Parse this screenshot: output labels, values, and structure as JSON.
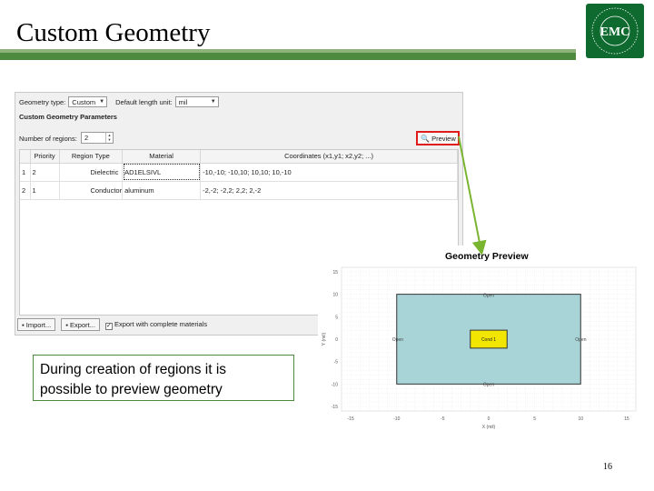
{
  "slide": {
    "title": "Custom Geometry",
    "page_number": "16"
  },
  "logo": {
    "text": "EMC",
    "ring_text": "TECHNOLOGY ELECTROMAGNETIC COMPATIBILITY"
  },
  "dialog": {
    "geometry_type_label": "Geometry type:",
    "geometry_type_value": "Custom",
    "length_unit_label": "Default length unit:",
    "length_unit_value": "mil",
    "params_title": "Custom Geometry Parameters",
    "num_regions_label": "Number of regions:",
    "num_regions_value": "2",
    "preview_button": "Preview",
    "table": {
      "headers": [
        "",
        "Priority",
        "Region Type",
        "Material",
        "Coordinates (x1,y1; x2,y2; ...)"
      ],
      "rows": [
        [
          "1",
          "2",
          "Dielectric",
          "AD1ELSIVL",
          "-10,-10; -10,10; 10,10; 10,-10"
        ],
        [
          "2",
          "1",
          "Conductor",
          "aluminum",
          "-2,-2; -2,2; 2,2; 2,-2"
        ]
      ]
    },
    "import_button": "Import...",
    "export_button": "Export...",
    "export_checkbox_label": "Export with complete materials",
    "export_checkbox_checked": true
  },
  "callout": {
    "text_line1": "During creation of regions it is",
    "text_line2": "possible to preview geometry"
  },
  "preview_window": {
    "title": "Geometry Preview",
    "y_label": "Y (mil)",
    "x_label": "X (mil)",
    "y_ticks": [
      "15",
      "10",
      "5",
      "0",
      "-5",
      "-10",
      "-15"
    ],
    "x_ticks": [
      "-15",
      "-10",
      "-5",
      "0",
      "5",
      "10",
      "15"
    ],
    "labels": {
      "top": "Open",
      "bottom": "Open",
      "left": "Open",
      "right": "Open",
      "center": "Cond 1"
    },
    "colors": {
      "dielectric": "#a8d4d8",
      "conductor": "#f2e600",
      "arrow": "#7ab532",
      "highlight": "#e01b1b"
    }
  }
}
